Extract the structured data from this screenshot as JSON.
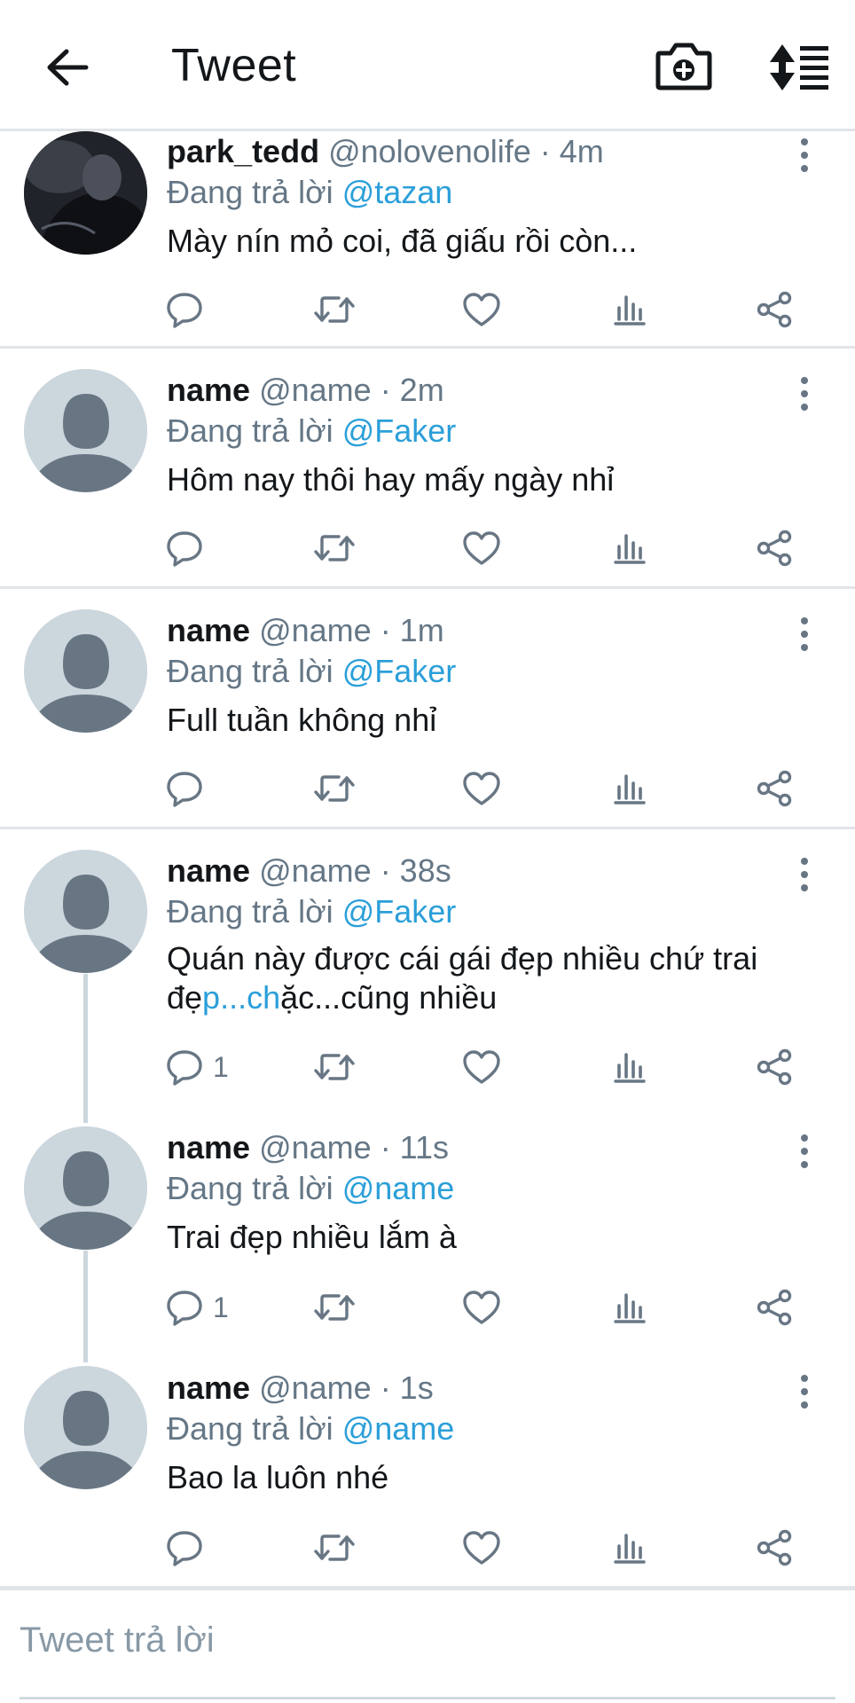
{
  "header": {
    "title": "Tweet",
    "back_icon": "arrow-left-icon",
    "camera_icon": "camera-plus-icon",
    "sort_icon": "sort-list-icon"
  },
  "colors": {
    "link": "#2b9fd9",
    "secondary_text": "#657786",
    "avatar_placeholder": "#ccd6dd",
    "avatar_figure": "#687684",
    "divider": "#e1e5e8"
  },
  "replies_prefix": "Đang trả lời",
  "tweets": [
    {
      "name": "park_tedd",
      "handle": "@nolovenolife",
      "time": "· 4m",
      "reply_to": "@tazan",
      "text": "Mày nín mỏ coi, đã giấu rồi còn...",
      "reply_count": ""
    },
    {
      "name": "name",
      "handle": "@name",
      "time": "· 2m",
      "reply_to": "@Faker",
      "text": "Hôm nay thôi hay mấy ngày nhỉ",
      "reply_count": ""
    },
    {
      "name": "name",
      "handle": "@name",
      "time": "· 1m",
      "reply_to": "@Faker",
      "text": "Full tuần không nhỉ",
      "reply_count": ""
    },
    {
      "name": "name",
      "handle": "@name",
      "time": "· 38s",
      "reply_to": "@Faker",
      "text_line1": "Quán này được cái gái đẹp nhiều chứ trai",
      "text_line2_a": "đẹ",
      "text_line2_link": "p...ch",
      "text_line2_b": "ặc...cũng nhiều",
      "reply_count": "1"
    },
    {
      "name": "name",
      "handle": "@name",
      "time": "· 11s",
      "reply_to": "@name",
      "text": "Trai đẹp nhiều lắm à",
      "reply_count": "1"
    },
    {
      "name": "name",
      "handle": "@name",
      "time": "· 1s",
      "reply_to": "@name",
      "text": "Bao la luôn nhé",
      "reply_count": ""
    }
  ],
  "compose": {
    "placeholder": "Tweet trả lời"
  }
}
